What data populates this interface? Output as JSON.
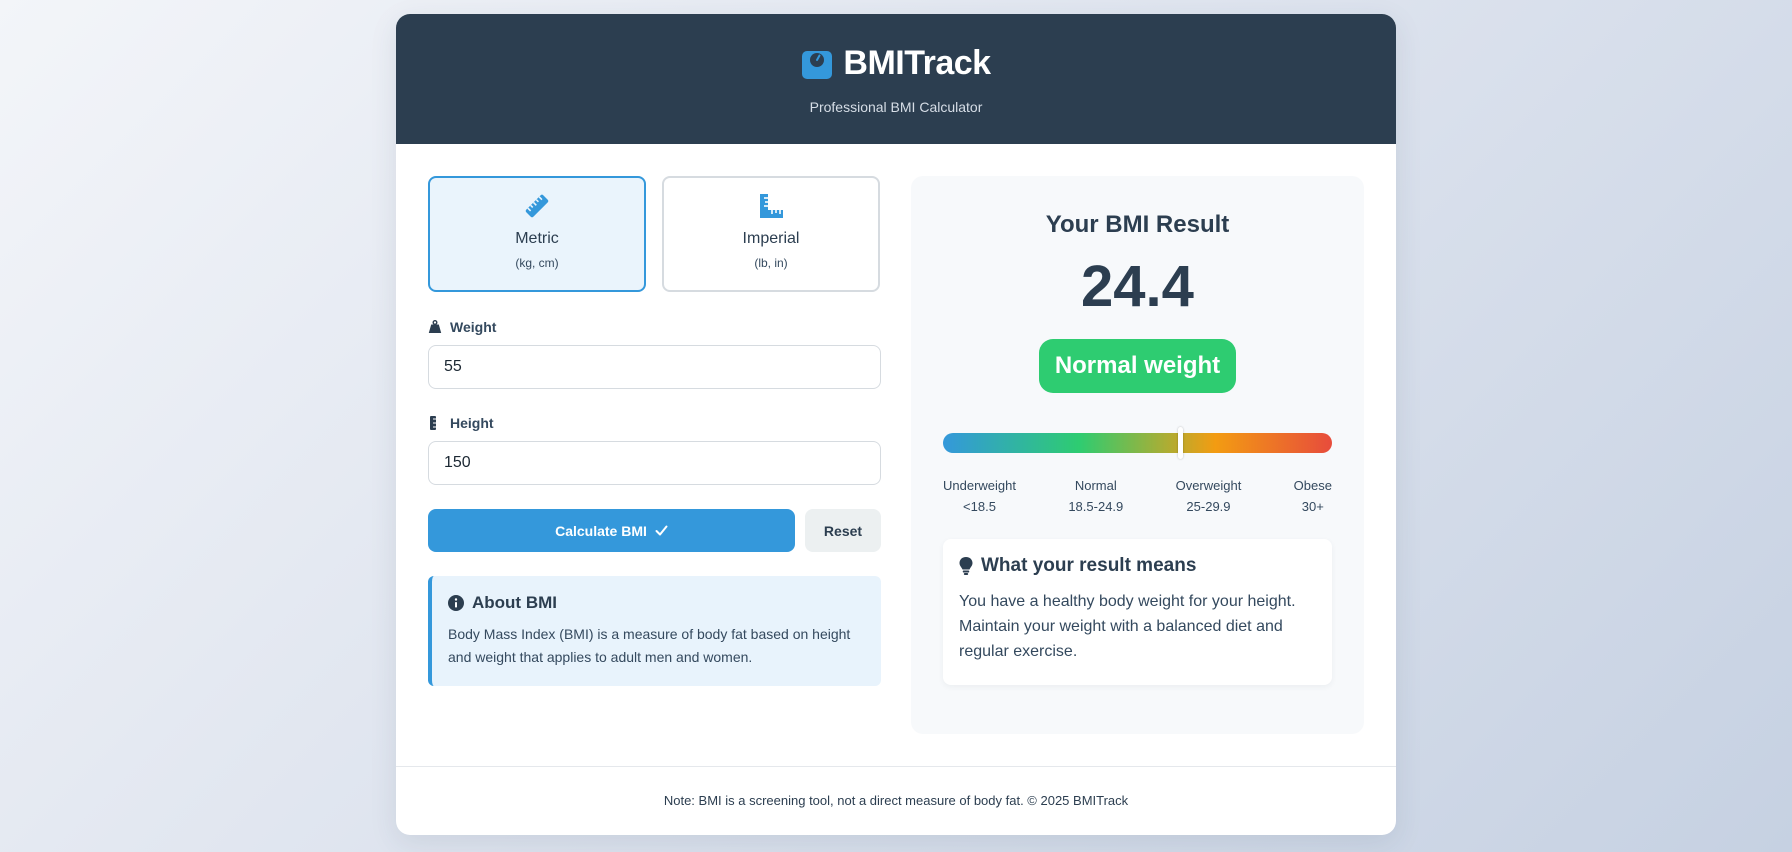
{
  "header": {
    "title": "BMITrack",
    "subtitle": "Professional BMI Calculator"
  },
  "units": [
    {
      "name": "Metric",
      "sub": "(kg, cm)",
      "active": true
    },
    {
      "name": "Imperial",
      "sub": "(lb, in)",
      "active": false
    }
  ],
  "form": {
    "weight_label": "Weight",
    "weight_value": "55",
    "height_label": "Height",
    "height_value": "150",
    "calculate_label": "Calculate BMI",
    "reset_label": "Reset"
  },
  "about": {
    "title": "About BMI",
    "text": "Body Mass Index (BMI) is a measure of body fat based on height and weight that applies to adult men and women."
  },
  "result": {
    "title": "Your BMI Result",
    "value": "24.4",
    "category": "Normal weight",
    "scale_position": 0.61,
    "scale": [
      {
        "label": "Underweight",
        "range": "<18.5"
      },
      {
        "label": "Normal",
        "range": "18.5-24.9"
      },
      {
        "label": "Overweight",
        "range": "25-29.9"
      },
      {
        "label": "Obese",
        "range": "30+"
      }
    ],
    "meaning_title": "What your result means",
    "meaning_text": "You have a healthy body weight for your height. Maintain your weight with a balanced diet and regular exercise."
  },
  "footer": {
    "note": "Note: BMI is a screening tool, not a direct measure of body fat. © 2025 BMITrack"
  },
  "colors": {
    "header": "#2c3e50",
    "accent": "#3498db",
    "success": "#2ecc71",
    "warning": "#f39c12",
    "danger": "#e74c3c"
  },
  "icons": {
    "brand": "weight-scale-icon",
    "metric": "ruler-icon",
    "imperial": "ruler-combined-icon",
    "weight": "weight-hanging-icon",
    "height": "ruler-vertical-icon",
    "calculate": "check-icon",
    "about": "info-circle-icon",
    "meaning": "lightbulb-icon"
  }
}
